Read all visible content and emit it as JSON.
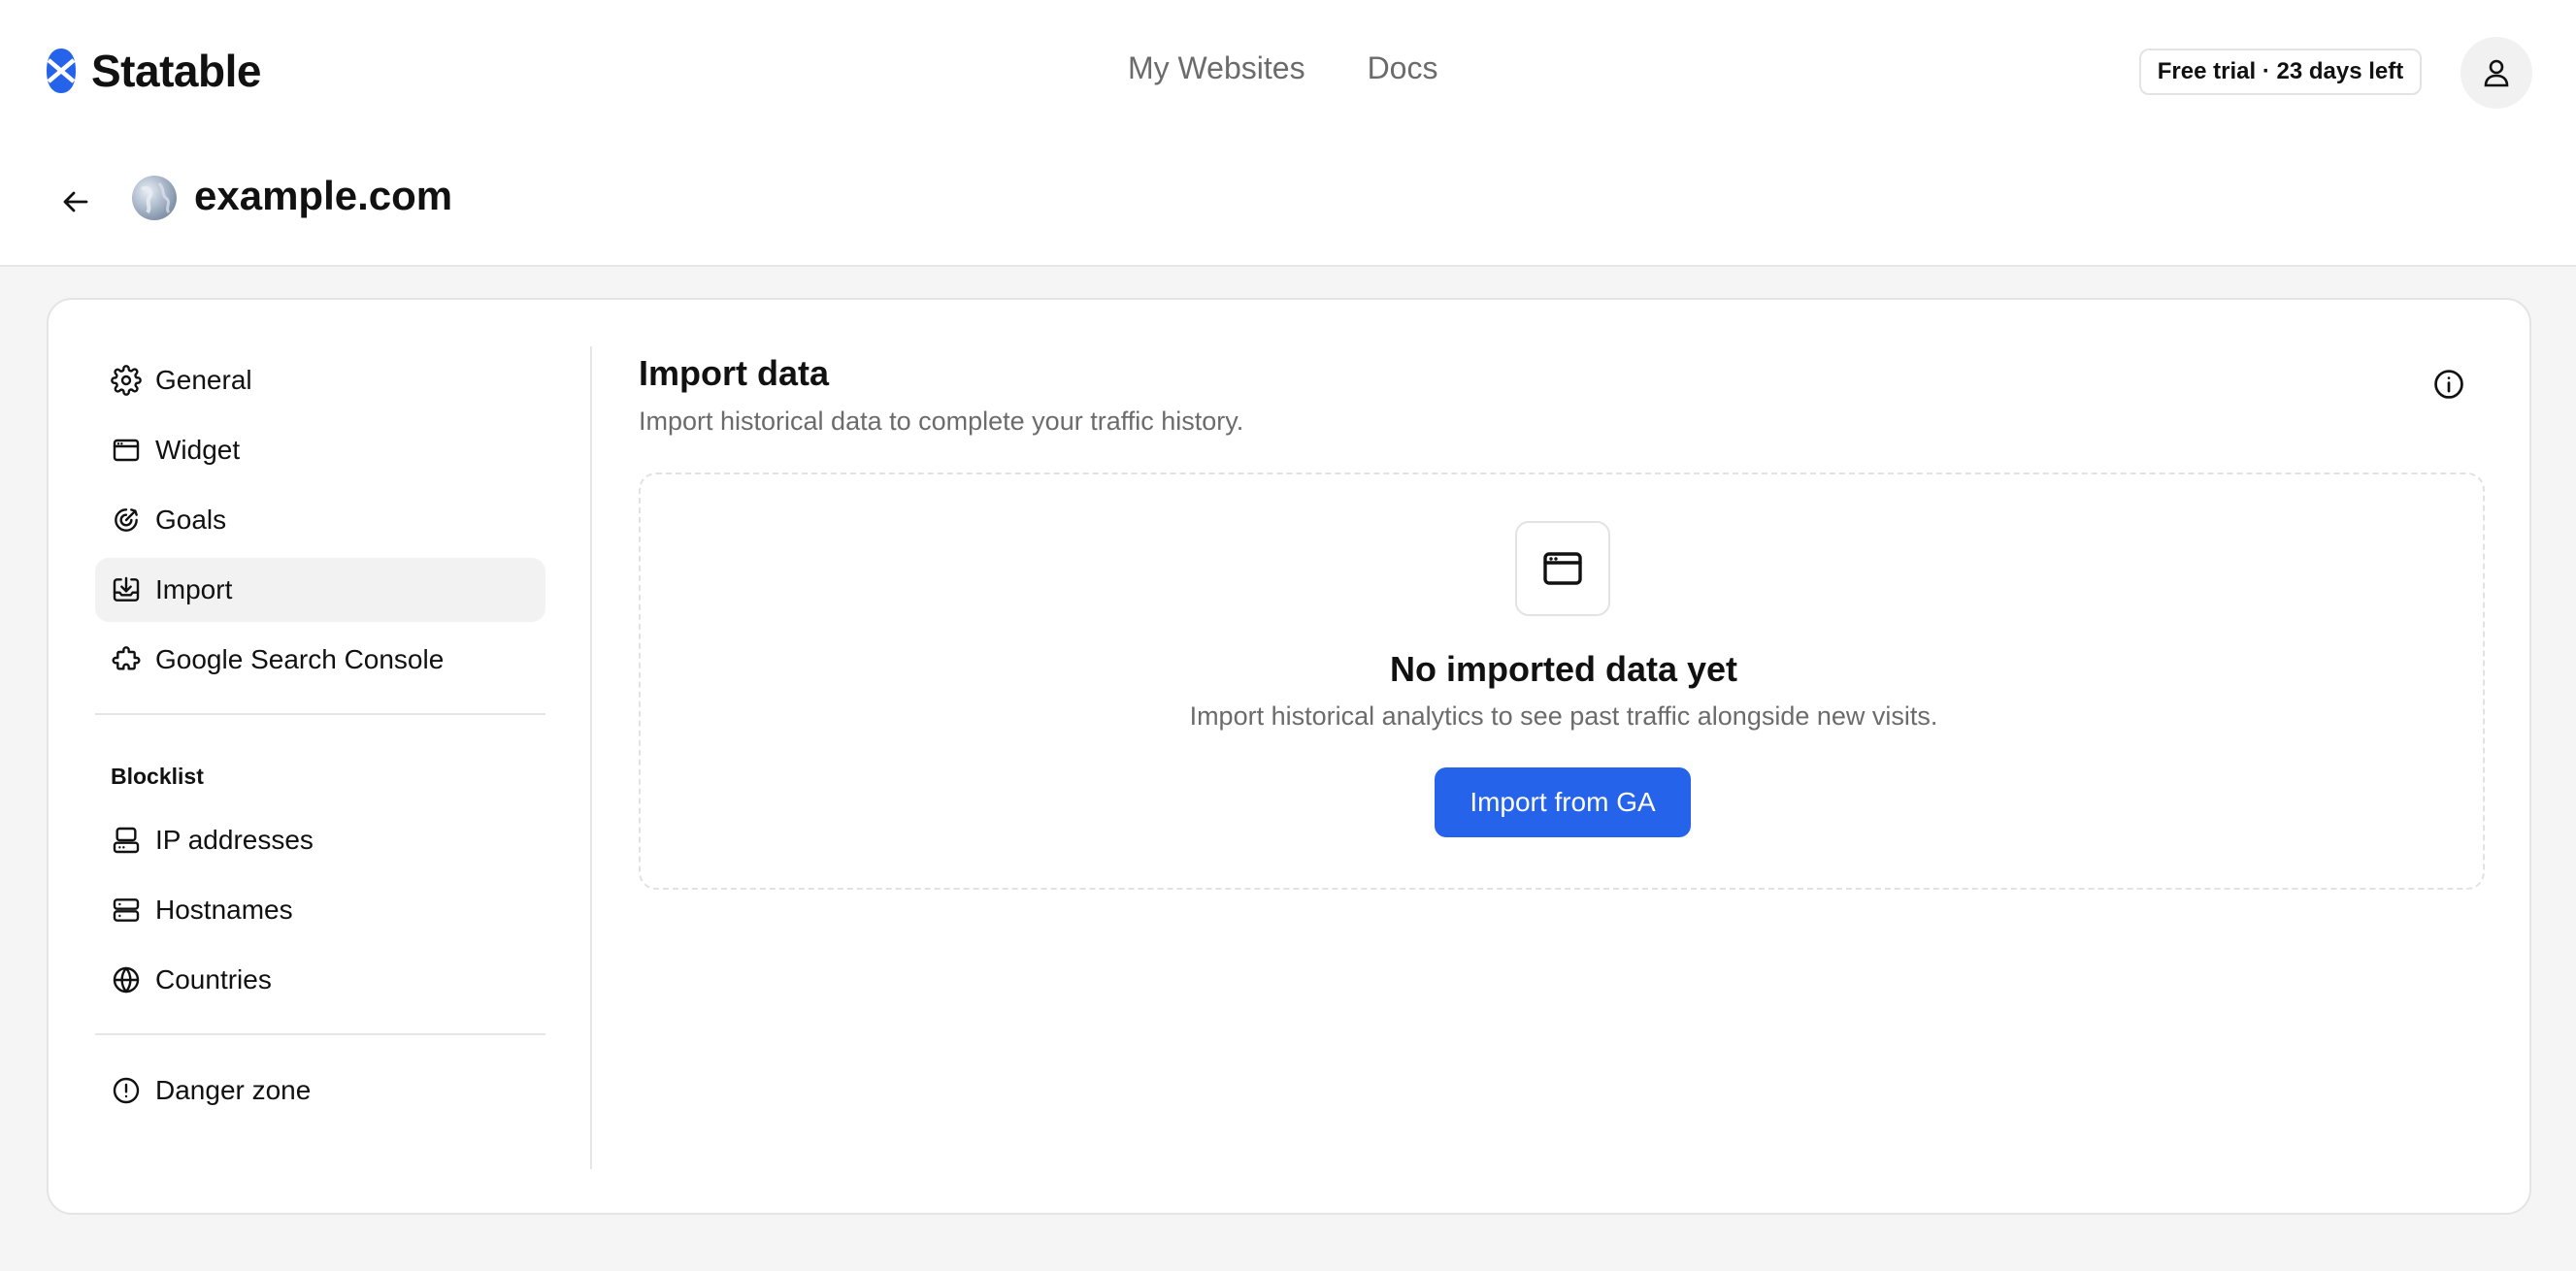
{
  "header": {
    "brand": "Statable",
    "nav": [
      "My Websites",
      "Docs"
    ],
    "trial_badge": "Free trial · 23 days left",
    "accent_color": "#2563eb"
  },
  "site": {
    "domain": "example.com"
  },
  "sidebar": {
    "items": [
      {
        "label": "General",
        "icon": "gear-icon"
      },
      {
        "label": "Widget",
        "icon": "browser-window-icon"
      },
      {
        "label": "Goals",
        "icon": "target-icon"
      },
      {
        "label": "Import",
        "icon": "import-tray-icon",
        "active": true
      },
      {
        "label": "Google Search Console",
        "icon": "puzzle-icon"
      }
    ],
    "blocklist_heading": "Blocklist",
    "blocklist_items": [
      {
        "label": "IP addresses",
        "icon": "server-icon"
      },
      {
        "label": "Hostnames",
        "icon": "server-stack-icon"
      },
      {
        "label": "Countries",
        "icon": "globe-icon"
      }
    ],
    "danger": {
      "label": "Danger zone",
      "icon": "alert-circle-icon"
    }
  },
  "content": {
    "title": "Import data",
    "subtitle": "Import historical data to complete your traffic history.",
    "empty_title": "No imported data yet",
    "empty_subtitle": "Import historical analytics to see past traffic alongside new visits.",
    "import_button": "Import from GA"
  }
}
